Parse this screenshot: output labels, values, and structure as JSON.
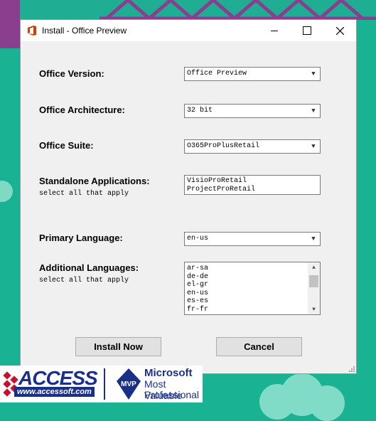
{
  "window": {
    "title": "Install - Office Preview",
    "controls": {
      "minimize_icon": "minimize-icon",
      "maximize_icon": "maximize-icon",
      "close_icon": "close-icon"
    }
  },
  "form": {
    "office_version": {
      "label": "Office Version:",
      "value": "Office Preview"
    },
    "office_architecture": {
      "label": "Office Architecture:",
      "value": "32 bit"
    },
    "office_suite": {
      "label": "Office Suite:",
      "value": "O365ProPlusRetail"
    },
    "standalone_apps": {
      "label": "Standalone Applications:",
      "hint": "select all that apply",
      "items": [
        "VisioProRetail",
        "ProjectProRetail"
      ]
    },
    "primary_language": {
      "label": "Primary Language:",
      "value": "en-us"
    },
    "additional_languages": {
      "label": "Additional Languages:",
      "hint": "select all that apply",
      "items": [
        "ar-sa",
        "de-de",
        "el-gr",
        "en-us",
        "es-es",
        "fr-fr"
      ]
    }
  },
  "buttons": {
    "install": "Install Now",
    "cancel": "Cancel"
  },
  "banner": {
    "access_word": "ACCESS",
    "access_url": "www.accessoft.com",
    "mvp_badge": "MVP",
    "mvp_line1": "Microsoft",
    "mvp_line2": "Most Valuable",
    "mvp_line3": "Professional"
  },
  "colors": {
    "background": "#19b394",
    "accent_purple": "#8a3f8e",
    "brand_blue": "#1a2f8a",
    "office_red": "#d83b01"
  }
}
